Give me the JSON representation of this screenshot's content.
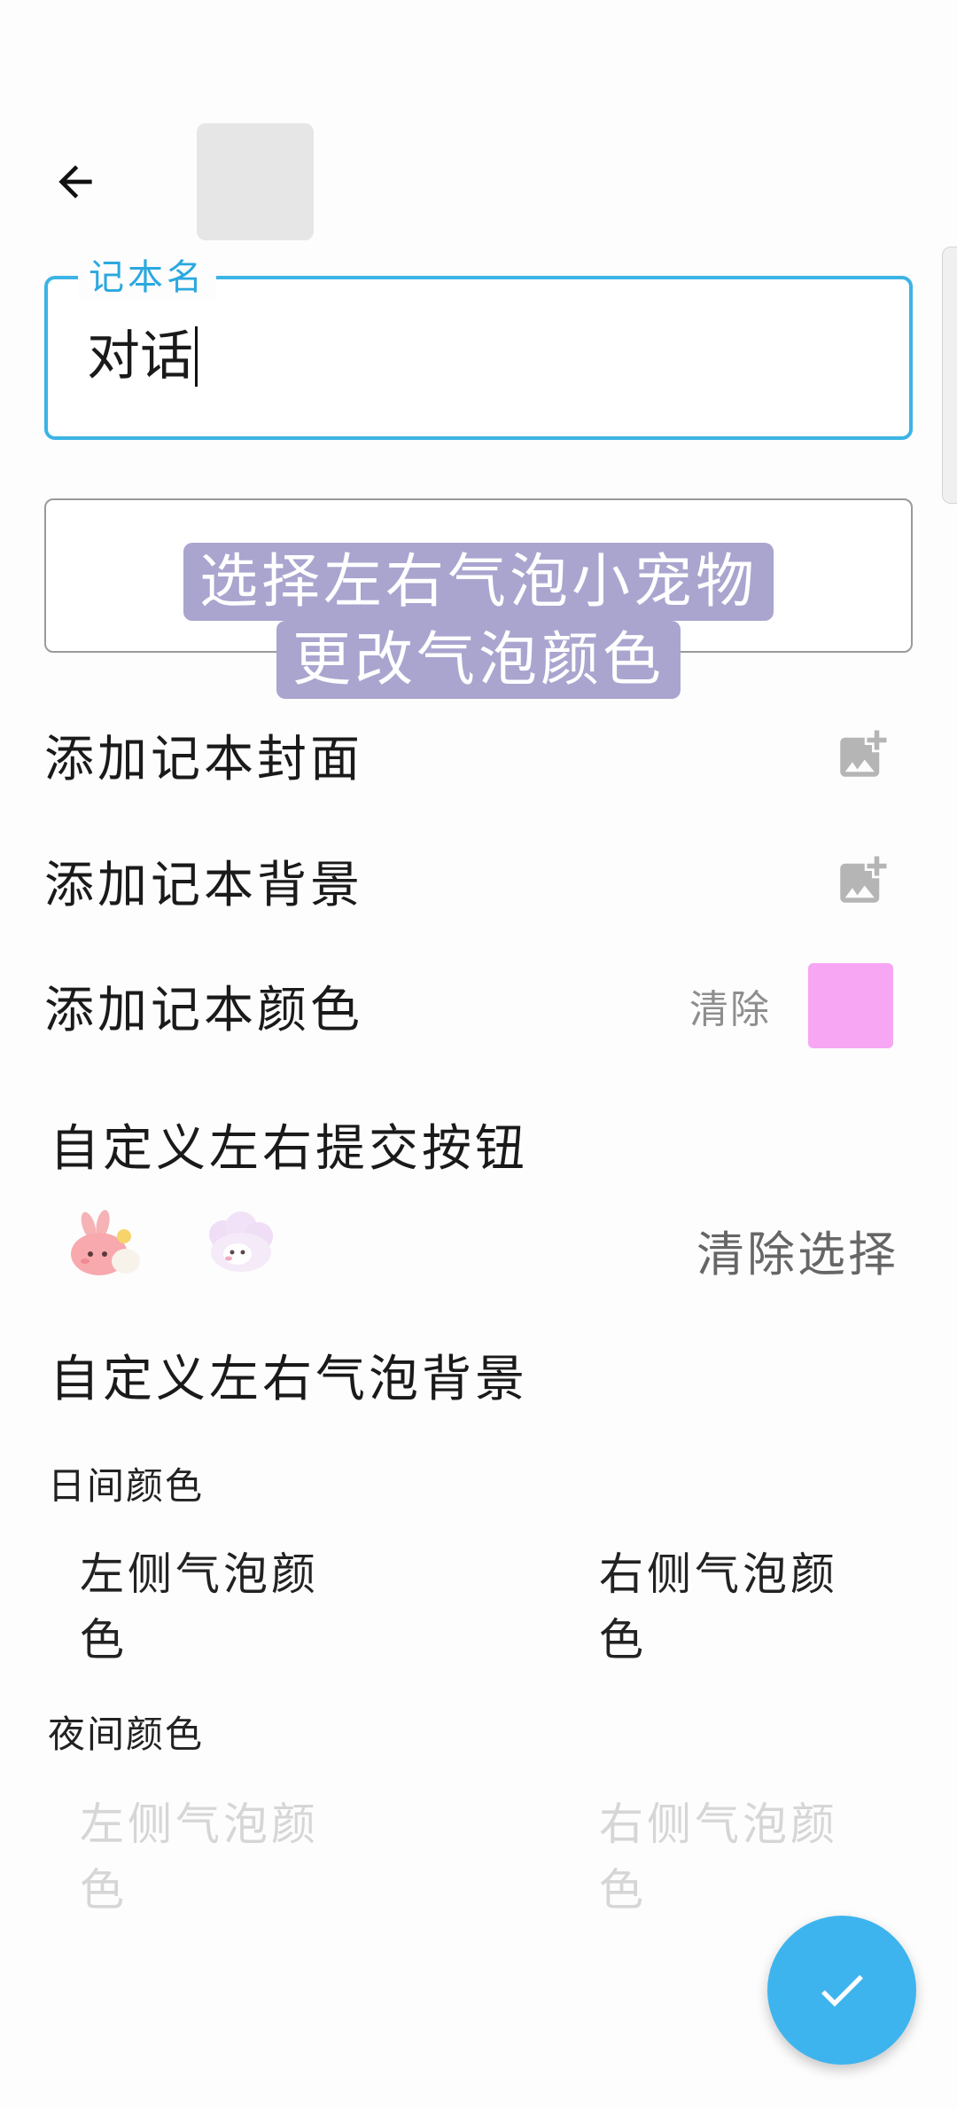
{
  "header": {
    "back_icon": "arrow-left-icon"
  },
  "name_field": {
    "label": "记本名",
    "value": "对话"
  },
  "overlay": {
    "line1": "选择左右气泡小宠物",
    "line2": "更改气泡颜色"
  },
  "rows": {
    "cover": {
      "label": "添加记本封面",
      "icon": "add-image-icon"
    },
    "background": {
      "label": "添加记本背景",
      "icon": "add-image-icon"
    },
    "color": {
      "label": "添加记本颜色",
      "clear_label": "清除",
      "swatch_color": "#f7a6f3"
    }
  },
  "submit_buttons": {
    "title": "自定义左右提交按钮",
    "left_pet": "bunny-icon",
    "right_pet": "sheep-icon",
    "clear_label": "清除选择"
  },
  "bubble_backgrounds": {
    "title": "自定义左右气泡背景",
    "day": {
      "title": "日间颜色",
      "left": "左侧气泡颜色",
      "right": "右侧气泡颜色"
    },
    "night": {
      "title": "夜间颜色",
      "left": "左侧气泡颜色",
      "right": "右侧气泡颜色"
    }
  },
  "fab": {
    "icon": "check-icon",
    "color": "#3db4ee"
  }
}
